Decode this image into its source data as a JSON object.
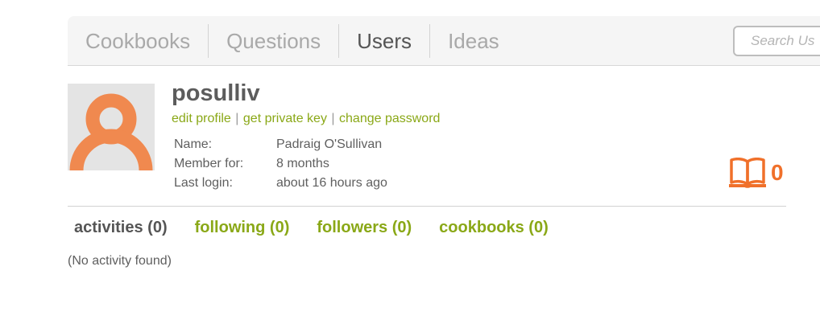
{
  "nav": {
    "tabs": [
      {
        "label": "Cookbooks"
      },
      {
        "label": "Questions"
      },
      {
        "label": "Users"
      },
      {
        "label": "Ideas"
      }
    ],
    "active_tab": "Users",
    "search_placeholder": "Search Us"
  },
  "profile": {
    "username": "posulliv",
    "links": {
      "edit_profile": "edit profile",
      "separator": "|",
      "get_private_key": "get private key",
      "change_password": "change password"
    },
    "info": [
      {
        "label": "Name:",
        "value": "Padraig O'Sullivan"
      },
      {
        "label": "Member for:",
        "value": "8 months"
      },
      {
        "label": "Last login:",
        "value": "about 16 hours ago"
      }
    ],
    "cookbook_count": "0",
    "cookbook_icon": "open-book-icon",
    "avatar_icon": "default-user-avatar-icon"
  },
  "subtabs": [
    {
      "label": "activities (0)"
    },
    {
      "label": "following (0)"
    },
    {
      "label": "followers (0)"
    },
    {
      "label": "cookbooks (0)"
    }
  ],
  "active_subtab": "activities (0)",
  "activity": {
    "empty_message": "(No activity found)"
  },
  "colors": {
    "link_green": "#8aa817",
    "accent_orange": "#f0702a",
    "avatar_orange": "#f0894f",
    "nav_bg": "#f5f5f5"
  }
}
